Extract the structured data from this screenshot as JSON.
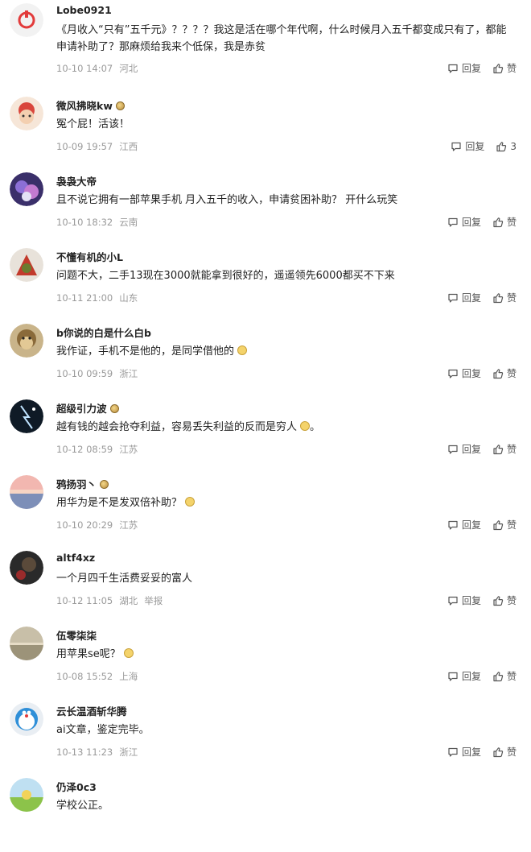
{
  "comments": [
    {
      "user": "Lobe0921",
      "badge": false,
      "text": "《月收入“只有”五千元》？？？？我这是活在哪个年代啊，什么时候月入五千都变成只有了，都能申请补助了？那麻烦给我来个低保，我是赤贫",
      "emoji": false,
      "time": "10-10 14:07",
      "location": "河北",
      "reply": "回复",
      "like": "赞",
      "avatar": "avatar-logo"
    },
    {
      "user": "微风拂晓kw",
      "badge": true,
      "text": "冤个屁！活该！",
      "emoji": false,
      "time": "10-09 19:57",
      "location": "江西",
      "reply": "回复",
      "like": "3",
      "avatar": "avatar-cartoon"
    },
    {
      "user": "袅袅大帝",
      "badge": false,
      "text": "且不说它拥有一部苹果手机 月入五千的收入，申请贫困补助？ 开什么玩笑",
      "emoji": false,
      "time": "10-10 18:32",
      "location": "云南",
      "reply": "回复",
      "like": "赞",
      "avatar": "avatar-purple"
    },
    {
      "user": "不懂有机的小L",
      "badge": false,
      "text": "问题不大，二手13现在3000就能拿到很好的，遥遥领先6000都买不下来",
      "emoji": false,
      "time": "10-11 21:00",
      "location": "山东",
      "reply": "回复",
      "like": "赞",
      "avatar": "avatar-red"
    },
    {
      "user": "b你说的白是什么白b",
      "badge": false,
      "text": "我作证，手机不是他的，是同学借他的",
      "emoji": true,
      "time": "10-10 09:59",
      "location": "浙江",
      "reply": "回复",
      "like": "赞",
      "avatar": "avatar-monkey"
    },
    {
      "user": "超级引力波",
      "badge": true,
      "text": "越有钱的越会抢夺利益，容易丢失利益的反而是穷人",
      "emoji": true,
      "text_suffix": "。",
      "time": "10-12 08:59",
      "location": "江苏",
      "reply": "回复",
      "like": "赞",
      "avatar": "avatar-night"
    },
    {
      "user": "鸦扬羽丶",
      "badge": true,
      "text": "用华为是不是发双倍补助？",
      "emoji": true,
      "time": "10-10 20:29",
      "location": "江苏",
      "reply": "回复",
      "like": "赞",
      "avatar": "avatar-sunset"
    },
    {
      "user": "altf4xz",
      "badge": false,
      "text": "一个月四千生活费妥妥的富人",
      "emoji": false,
      "time": "10-12 11:05",
      "location": "湖北",
      "extra": "举报",
      "reply": "回复",
      "like": "赞",
      "avatar": "avatar-dark"
    },
    {
      "user": "伍零柒柒",
      "badge": false,
      "text": "用苹果se呢？",
      "emoji": true,
      "time": "10-08 15:52",
      "location": "上海",
      "reply": "回复",
      "like": "赞",
      "avatar": "avatar-sea"
    },
    {
      "user": "云长温酒斩华腾",
      "badge": false,
      "text": "ai文章，鉴定完毕。",
      "emoji": false,
      "time": "10-13 11:23",
      "location": "浙江",
      "reply": "回复",
      "like": "赞",
      "avatar": "avatar-doraemon"
    },
    {
      "user": "仍泽0c3",
      "badge": false,
      "text": "学校公正。",
      "emoji": false,
      "time": "",
      "location": "",
      "reply": "",
      "like": "",
      "avatar": "avatar-field"
    }
  ],
  "colors": {
    "text": "#222222",
    "meta": "#9a9a9a",
    "action": "#555555"
  }
}
